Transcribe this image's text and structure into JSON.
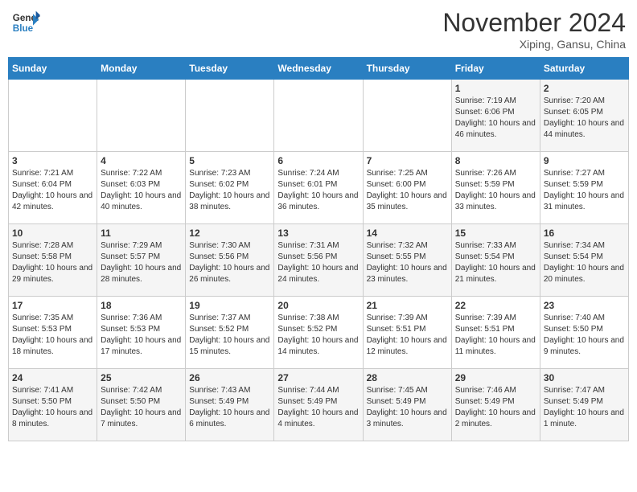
{
  "header": {
    "logo_line1": "General",
    "logo_line2": "Blue",
    "month": "November 2024",
    "location": "Xiping, Gansu, China"
  },
  "days_of_week": [
    "Sunday",
    "Monday",
    "Tuesday",
    "Wednesday",
    "Thursday",
    "Friday",
    "Saturday"
  ],
  "weeks": [
    [
      {
        "day": "",
        "info": ""
      },
      {
        "day": "",
        "info": ""
      },
      {
        "day": "",
        "info": ""
      },
      {
        "day": "",
        "info": ""
      },
      {
        "day": "",
        "info": ""
      },
      {
        "day": "1",
        "info": "Sunrise: 7:19 AM\nSunset: 6:06 PM\nDaylight: 10 hours and 46 minutes."
      },
      {
        "day": "2",
        "info": "Sunrise: 7:20 AM\nSunset: 6:05 PM\nDaylight: 10 hours and 44 minutes."
      }
    ],
    [
      {
        "day": "3",
        "info": "Sunrise: 7:21 AM\nSunset: 6:04 PM\nDaylight: 10 hours and 42 minutes."
      },
      {
        "day": "4",
        "info": "Sunrise: 7:22 AM\nSunset: 6:03 PM\nDaylight: 10 hours and 40 minutes."
      },
      {
        "day": "5",
        "info": "Sunrise: 7:23 AM\nSunset: 6:02 PM\nDaylight: 10 hours and 38 minutes."
      },
      {
        "day": "6",
        "info": "Sunrise: 7:24 AM\nSunset: 6:01 PM\nDaylight: 10 hours and 36 minutes."
      },
      {
        "day": "7",
        "info": "Sunrise: 7:25 AM\nSunset: 6:00 PM\nDaylight: 10 hours and 35 minutes."
      },
      {
        "day": "8",
        "info": "Sunrise: 7:26 AM\nSunset: 5:59 PM\nDaylight: 10 hours and 33 minutes."
      },
      {
        "day": "9",
        "info": "Sunrise: 7:27 AM\nSunset: 5:59 PM\nDaylight: 10 hours and 31 minutes."
      }
    ],
    [
      {
        "day": "10",
        "info": "Sunrise: 7:28 AM\nSunset: 5:58 PM\nDaylight: 10 hours and 29 minutes."
      },
      {
        "day": "11",
        "info": "Sunrise: 7:29 AM\nSunset: 5:57 PM\nDaylight: 10 hours and 28 minutes."
      },
      {
        "day": "12",
        "info": "Sunrise: 7:30 AM\nSunset: 5:56 PM\nDaylight: 10 hours and 26 minutes."
      },
      {
        "day": "13",
        "info": "Sunrise: 7:31 AM\nSunset: 5:56 PM\nDaylight: 10 hours and 24 minutes."
      },
      {
        "day": "14",
        "info": "Sunrise: 7:32 AM\nSunset: 5:55 PM\nDaylight: 10 hours and 23 minutes."
      },
      {
        "day": "15",
        "info": "Sunrise: 7:33 AM\nSunset: 5:54 PM\nDaylight: 10 hours and 21 minutes."
      },
      {
        "day": "16",
        "info": "Sunrise: 7:34 AM\nSunset: 5:54 PM\nDaylight: 10 hours and 20 minutes."
      }
    ],
    [
      {
        "day": "17",
        "info": "Sunrise: 7:35 AM\nSunset: 5:53 PM\nDaylight: 10 hours and 18 minutes."
      },
      {
        "day": "18",
        "info": "Sunrise: 7:36 AM\nSunset: 5:53 PM\nDaylight: 10 hours and 17 minutes."
      },
      {
        "day": "19",
        "info": "Sunrise: 7:37 AM\nSunset: 5:52 PM\nDaylight: 10 hours and 15 minutes."
      },
      {
        "day": "20",
        "info": "Sunrise: 7:38 AM\nSunset: 5:52 PM\nDaylight: 10 hours and 14 minutes."
      },
      {
        "day": "21",
        "info": "Sunrise: 7:39 AM\nSunset: 5:51 PM\nDaylight: 10 hours and 12 minutes."
      },
      {
        "day": "22",
        "info": "Sunrise: 7:39 AM\nSunset: 5:51 PM\nDaylight: 10 hours and 11 minutes."
      },
      {
        "day": "23",
        "info": "Sunrise: 7:40 AM\nSunset: 5:50 PM\nDaylight: 10 hours and 9 minutes."
      }
    ],
    [
      {
        "day": "24",
        "info": "Sunrise: 7:41 AM\nSunset: 5:50 PM\nDaylight: 10 hours and 8 minutes."
      },
      {
        "day": "25",
        "info": "Sunrise: 7:42 AM\nSunset: 5:50 PM\nDaylight: 10 hours and 7 minutes."
      },
      {
        "day": "26",
        "info": "Sunrise: 7:43 AM\nSunset: 5:49 PM\nDaylight: 10 hours and 6 minutes."
      },
      {
        "day": "27",
        "info": "Sunrise: 7:44 AM\nSunset: 5:49 PM\nDaylight: 10 hours and 4 minutes."
      },
      {
        "day": "28",
        "info": "Sunrise: 7:45 AM\nSunset: 5:49 PM\nDaylight: 10 hours and 3 minutes."
      },
      {
        "day": "29",
        "info": "Sunrise: 7:46 AM\nSunset: 5:49 PM\nDaylight: 10 hours and 2 minutes."
      },
      {
        "day": "30",
        "info": "Sunrise: 7:47 AM\nSunset: 5:49 PM\nDaylight: 10 hours and 1 minute."
      }
    ]
  ]
}
